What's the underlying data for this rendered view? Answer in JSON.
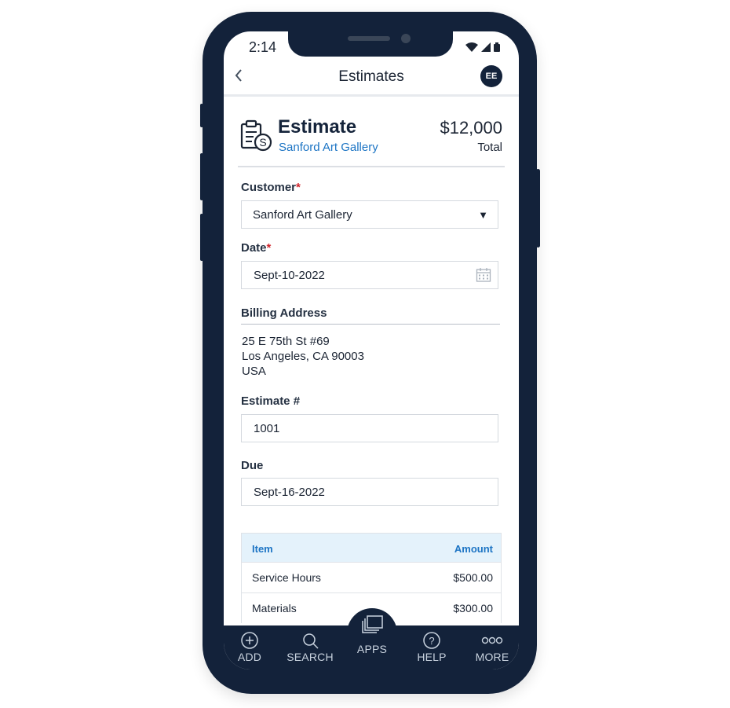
{
  "status_bar": {
    "time": "2:14"
  },
  "header": {
    "title": "Estimates",
    "avatar": "EE"
  },
  "summary": {
    "title": "Estimate",
    "customer": "Sanford Art Gallery",
    "amount": "$12,000",
    "amount_label": "Total"
  },
  "form": {
    "customer": {
      "label": "Customer",
      "required": "*",
      "value": "Sanford Art Gallery"
    },
    "date": {
      "label": "Date",
      "required": "*",
      "value": "Sept-10-2022"
    },
    "billing": {
      "label": "Billing Address",
      "lines": [
        "25 E 75th St #69",
        "Los Angeles, CA 90003",
        "USA"
      ]
    },
    "estimate_no": {
      "label": "Estimate #",
      "value": "1001"
    },
    "due": {
      "label": "Due",
      "value": "Sept-16-2022"
    }
  },
  "table": {
    "headers": {
      "item": "Item",
      "amount": "Amount"
    },
    "rows": [
      {
        "item": "Service Hours",
        "amount": "$500.00"
      },
      {
        "item": "Materials",
        "amount": "$300.00"
      }
    ]
  },
  "nav": {
    "items": [
      {
        "label": "ADD",
        "icon": "add-icon"
      },
      {
        "label": "SEARCH",
        "icon": "search-icon"
      },
      {
        "label": "APPS",
        "icon": "apps-icon"
      },
      {
        "label": "HELP",
        "icon": "help-icon"
      },
      {
        "label": "MORE",
        "icon": "more-icon"
      }
    ]
  },
  "colors": {
    "navy": "#13223a",
    "link": "#1c74c4",
    "required": "#d1262d",
    "table_header_bg": "#e4f2fb"
  }
}
